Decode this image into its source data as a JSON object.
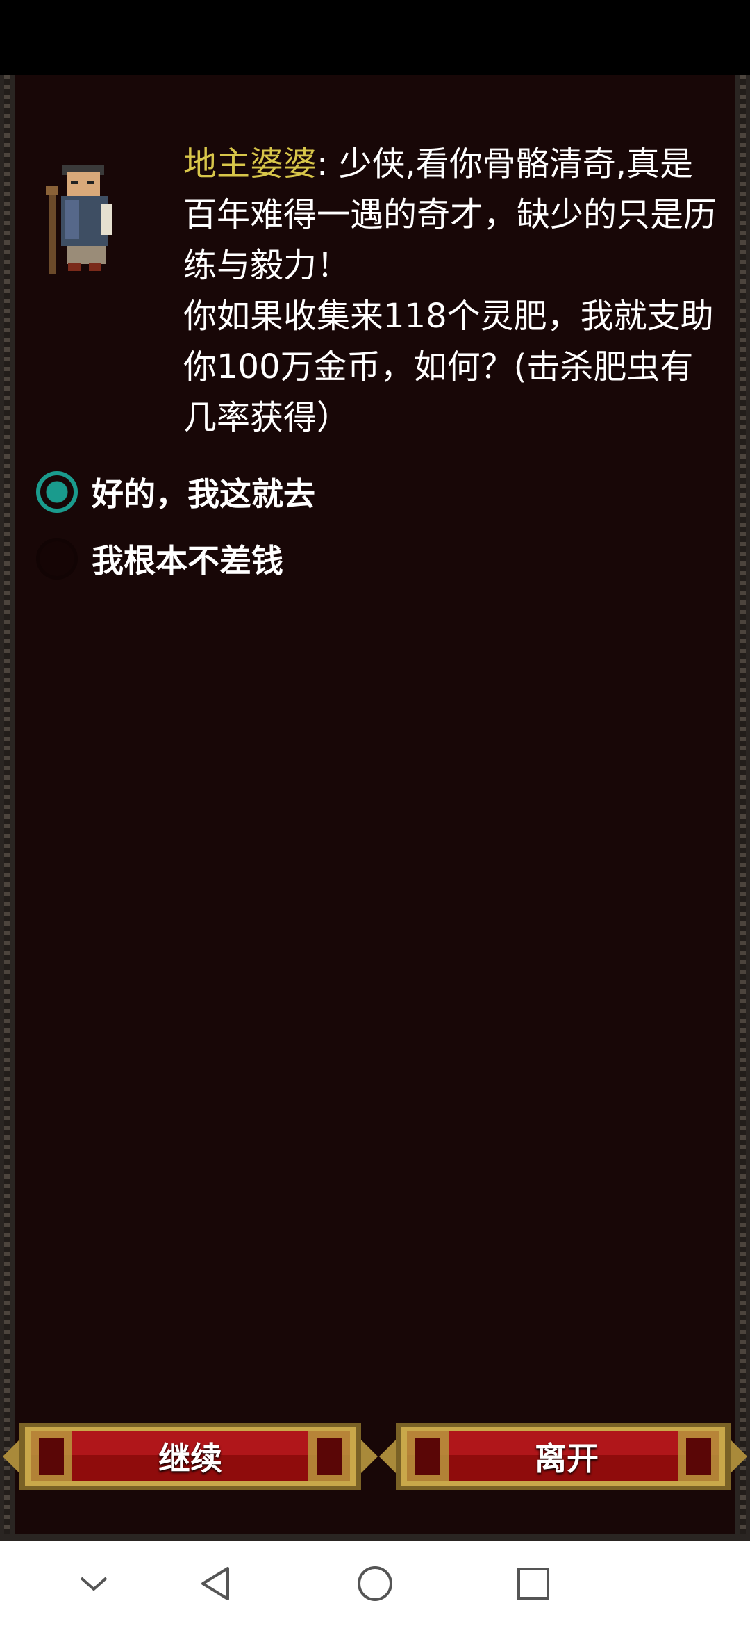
{
  "dialog": {
    "speaker": "地主婆婆",
    "separator": ": ",
    "line1": "少侠,看你骨骼清奇,真是百年难得一遇的奇才，缺少的只是历练与毅力！",
    "line2": "你如果收集来118个灵肥，我就支助你100万金币，如何？(击杀肥虫有几率获得）"
  },
  "options": [
    {
      "label": "好的，我这就去",
      "selected": true
    },
    {
      "label": "我根本不差钱",
      "selected": false
    }
  ],
  "buttons": {
    "continue_label": "继续",
    "leave_label": "离开"
  },
  "colors": {
    "speaker": "#d8c64a",
    "radio_accent": "#1a9b8d",
    "panel_bg": "#180707"
  },
  "icons": {
    "nav_down": "chevron-down-icon",
    "nav_back": "back-triangle-icon",
    "nav_home": "home-circle-icon",
    "nav_recent": "recent-square-icon"
  }
}
